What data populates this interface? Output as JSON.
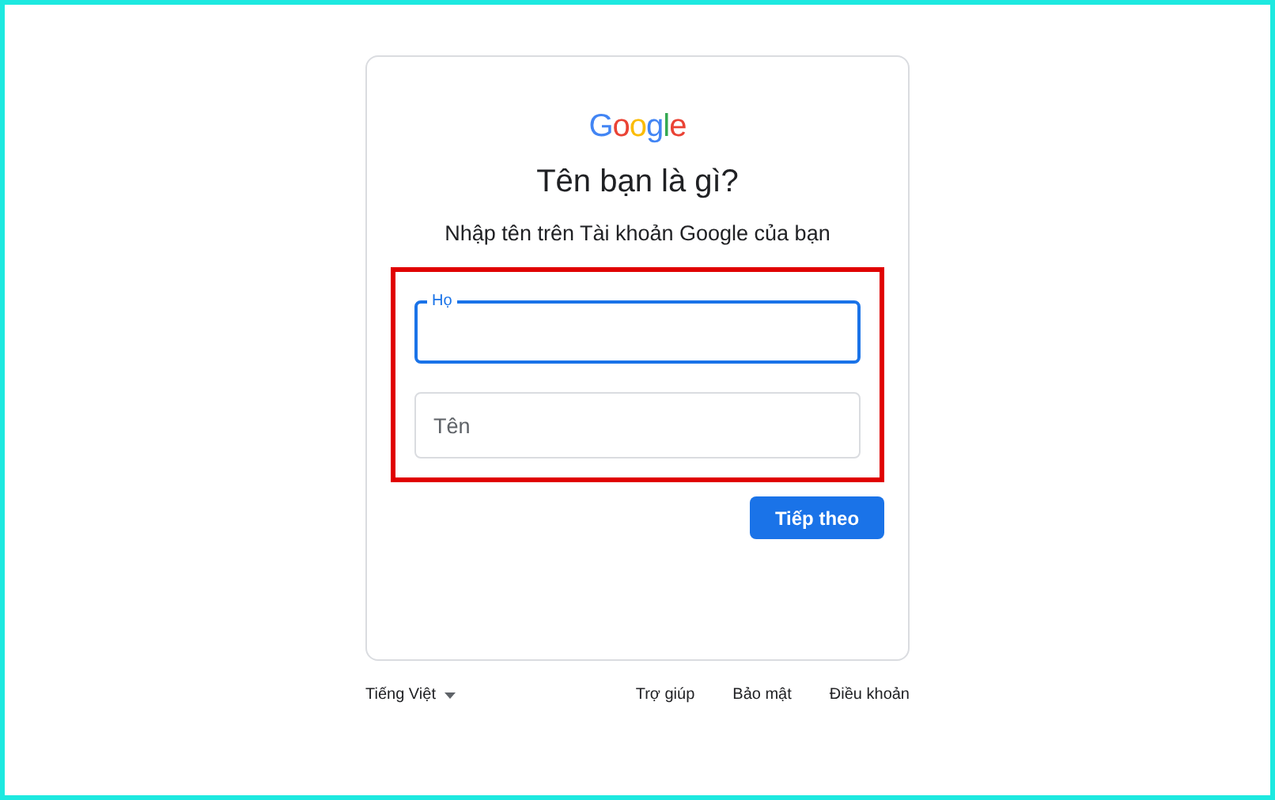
{
  "card": {
    "logo": "Google",
    "title": "Tên bạn là gì?",
    "subtitle": "Nhập tên trên Tài khoản Google của bạn",
    "fields": [
      {
        "label": "Họ",
        "focused": true
      },
      {
        "label": "Tên",
        "focused": false
      }
    ],
    "next_button": "Tiếp theo"
  },
  "footer": {
    "language": "Tiếng Việt",
    "links": [
      "Trợ giúp",
      "Bảo mật",
      "Điều khoản"
    ]
  }
}
